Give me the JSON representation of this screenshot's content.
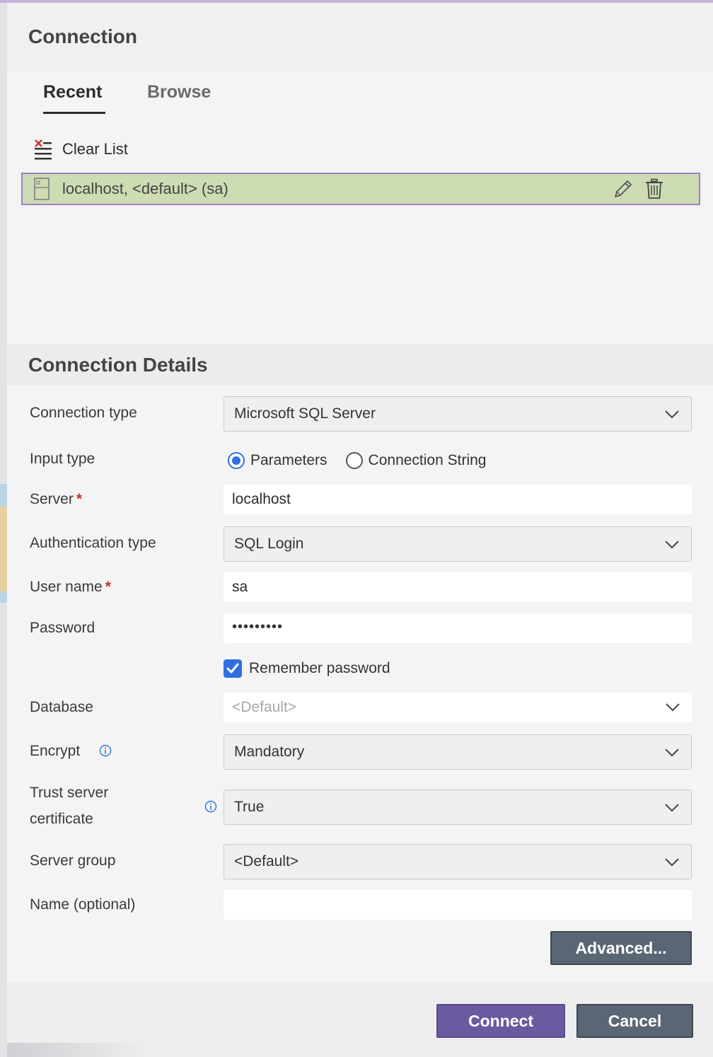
{
  "dialog": {
    "title": "Connection"
  },
  "tabs": [
    {
      "label": "Recent",
      "active": true
    },
    {
      "label": "Browse",
      "active": false
    }
  ],
  "recent": {
    "clear_label": "Clear List",
    "items": [
      {
        "label": "localhost, <default> (sa)",
        "selected": true
      }
    ]
  },
  "details": {
    "title": "Connection Details",
    "connection_type": {
      "label": "Connection type",
      "value": "Microsoft SQL Server"
    },
    "input_type": {
      "label": "Input type",
      "options": [
        {
          "label": "Parameters",
          "checked": true
        },
        {
          "label": "Connection String",
          "checked": false
        }
      ]
    },
    "server": {
      "label": "Server",
      "required_mark": "*",
      "value": "localhost"
    },
    "auth_type": {
      "label": "Authentication type",
      "value": "SQL Login"
    },
    "user_name": {
      "label": "User name",
      "required_mark": "*",
      "value": "sa"
    },
    "password": {
      "label": "Password",
      "masked_value": "•••••••••"
    },
    "remember_password": {
      "label": "Remember password",
      "checked": true
    },
    "database": {
      "label": "Database",
      "placeholder": "<Default>"
    },
    "encrypt": {
      "label": "Encrypt",
      "value": "Mandatory"
    },
    "trust_cert": {
      "label_line1": "Trust server",
      "label_line2": "certificate",
      "value": "True"
    },
    "server_group": {
      "label": "Server group",
      "value": "<Default>"
    },
    "name_optional": {
      "label": "Name (optional)",
      "value": ""
    }
  },
  "buttons": {
    "advanced": "Advanced...",
    "connect": "Connect",
    "cancel": "Cancel"
  },
  "colors": {
    "accent": "#2f6fe0",
    "selected_row": "#cddcb3",
    "selected_border": "#9d7fc7",
    "connect_button": "#6b5aa0",
    "secondary_button": "#5b6675",
    "required": "#d0302c"
  }
}
